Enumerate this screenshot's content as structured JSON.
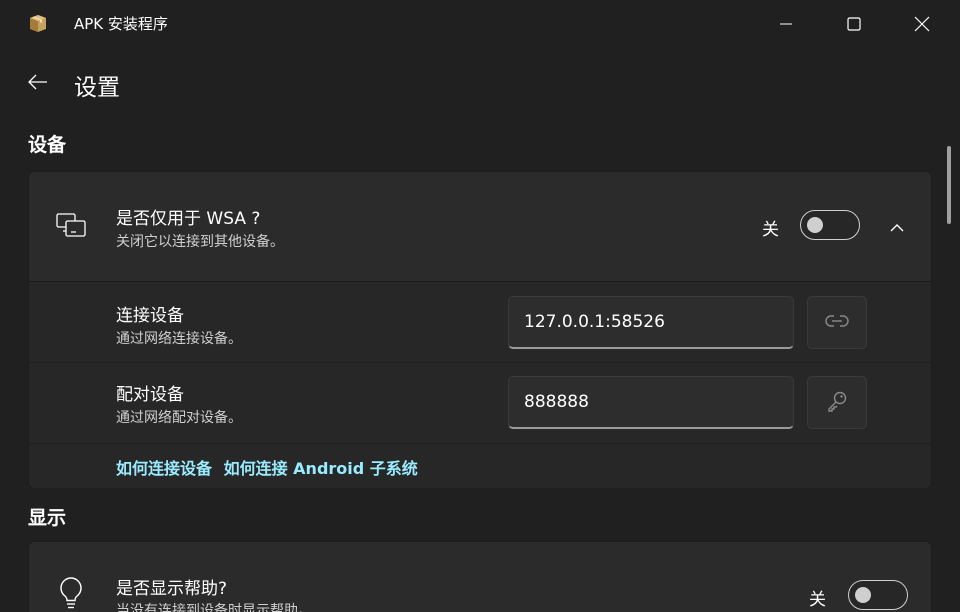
{
  "window": {
    "title": "APK 安装程序",
    "icon": "package-box-icon"
  },
  "page": {
    "title": "设置"
  },
  "device_section": {
    "title": "设备",
    "wsa_card": {
      "title": "是否仅用于 WSA ?",
      "description": "关闭它以连接到其他设备。",
      "toggle_label": "关",
      "toggle_on": false,
      "expanded": true,
      "icon": "devices-icon"
    },
    "connect_row": {
      "title": "连接设备",
      "description": "通过网络连接设备。",
      "input_value": "127.0.0.1:58526",
      "button_icon": "link-icon"
    },
    "pair_row": {
      "title": "配对设备",
      "description": "通过网络配对设备。",
      "input_value": "888888",
      "button_icon": "key-icon"
    },
    "links": {
      "how_to_connect": "如何连接设备",
      "how_to_connect_android": "如何连接 Android 子系统"
    }
  },
  "display_section": {
    "title": "显示",
    "help_card": {
      "title": "是否显示帮助?",
      "description": "当没有连接到设备时显示帮助。",
      "toggle_label": "关",
      "toggle_on": false,
      "icon": "lightbulb-icon"
    }
  },
  "colors": {
    "background": "#202020",
    "card": "#2b2b2b",
    "accent_link": "#99ebff"
  }
}
